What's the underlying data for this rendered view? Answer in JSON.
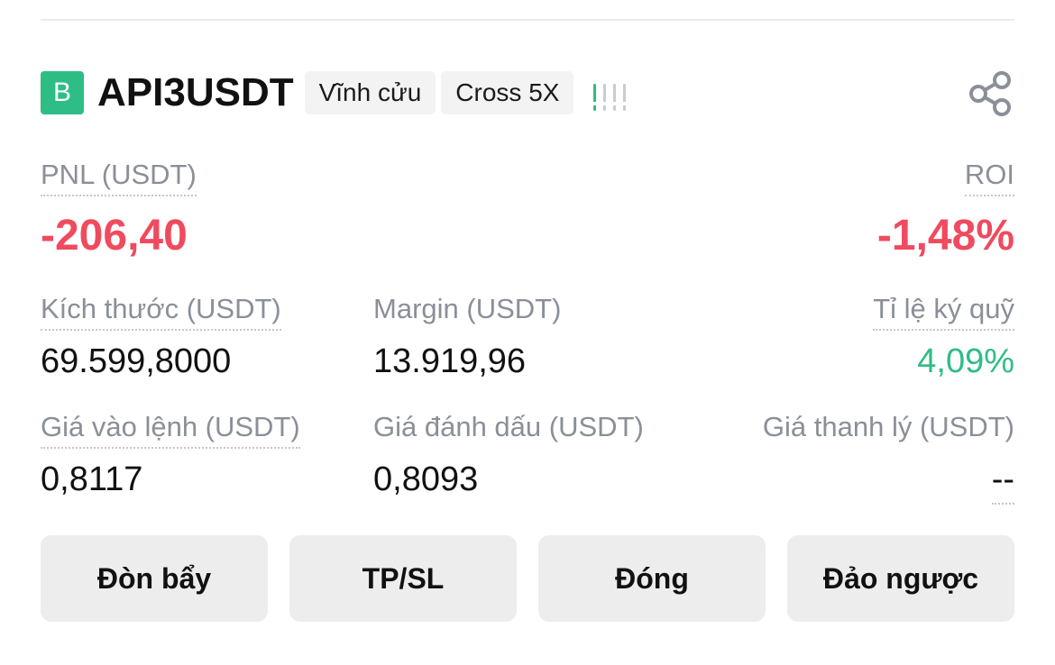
{
  "position": {
    "side_badge": "B",
    "symbol": "API3USDT",
    "tags": [
      "Vĩnh cửu",
      "Cross 5X"
    ],
    "share_icon": "share-icon",
    "signal_icon": "signal-strength-icon"
  },
  "pnl": {
    "label": "PNL (USDT)",
    "value": "-206,40"
  },
  "roi": {
    "label": "ROI",
    "value": "-1,48%"
  },
  "size": {
    "label": "Kích thước (USDT)",
    "value": "69.599,8000"
  },
  "margin": {
    "label": "Margin (USDT)",
    "value": "13.919,96"
  },
  "margin_ratio": {
    "label": "Tỉ lệ ký quỹ",
    "value": "4,09%"
  },
  "entry_price": {
    "label": "Giá vào lệnh (USDT)",
    "value": "0,8117"
  },
  "mark_price": {
    "label": "Giá đánh dấu (USDT)",
    "value": "0,8093"
  },
  "liq_price": {
    "label": "Giá thanh lý (USDT)",
    "value": "--"
  },
  "actions": {
    "leverage": "Đòn bẩy",
    "tpsl": "TP/SL",
    "close": "Đóng",
    "reverse": "Đảo ngược"
  },
  "colors": {
    "buy_green": "#2ebd85",
    "loss_red": "#f04a5f",
    "label_gray": "#8a8f99"
  }
}
